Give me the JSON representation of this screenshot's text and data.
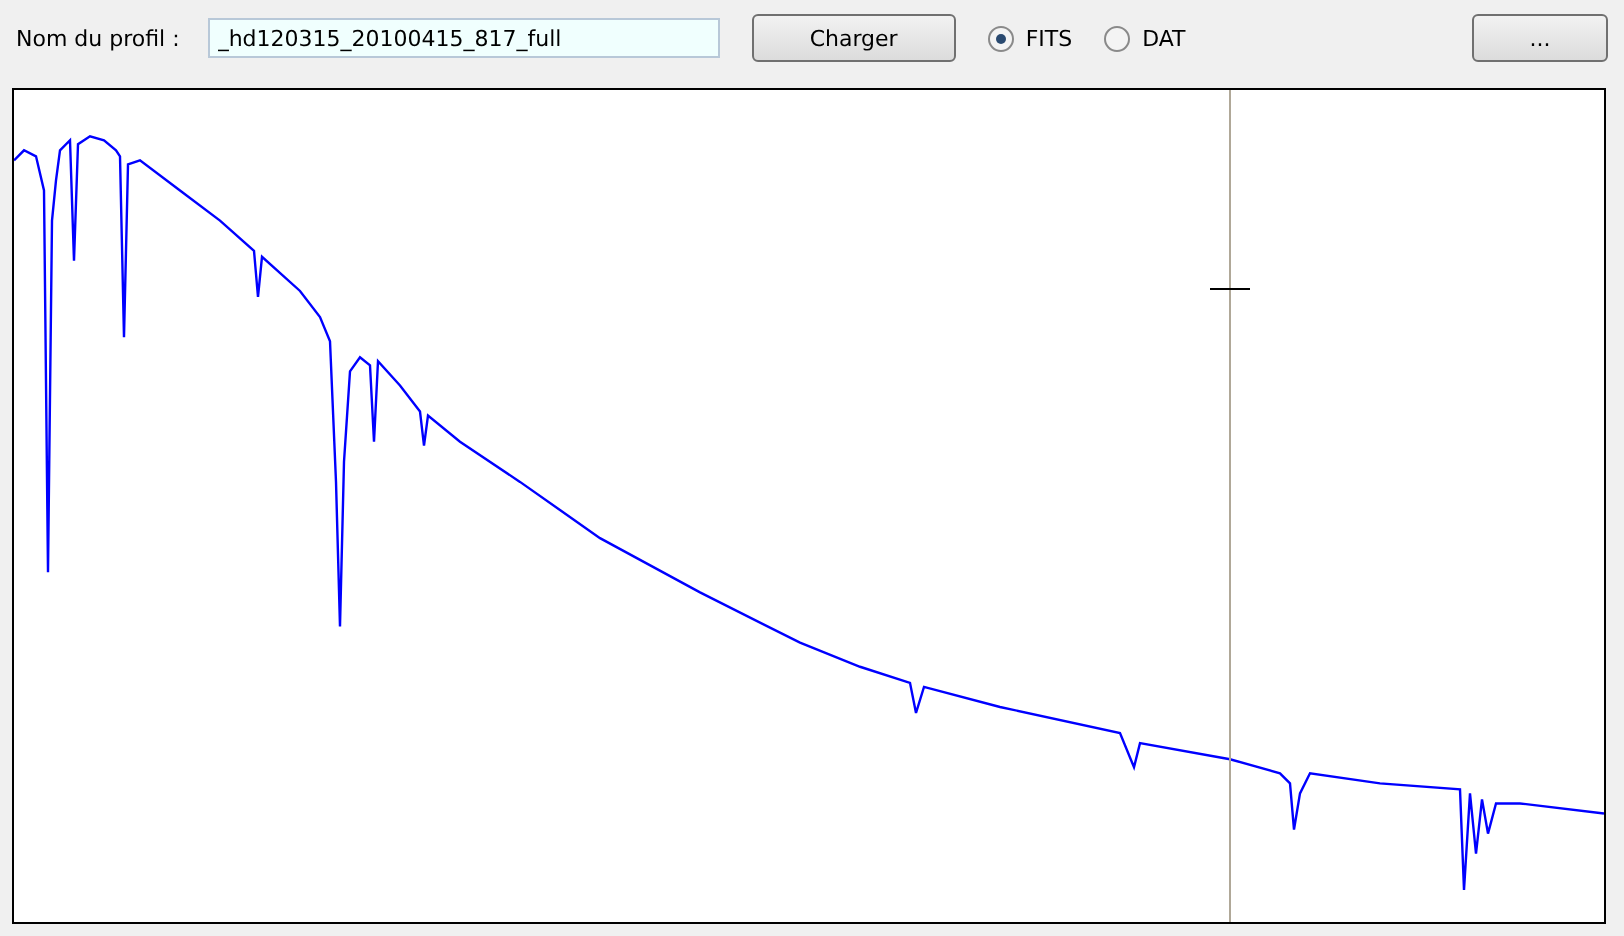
{
  "profile": {
    "label": "Nom du profil :",
    "value": "_hd120315_20100415_817_full"
  },
  "load_button": "Charger",
  "formats": [
    {
      "label": "FITS",
      "selected": true
    },
    {
      "label": "DAT",
      "selected": false
    }
  ],
  "browse_button": "..."
}
